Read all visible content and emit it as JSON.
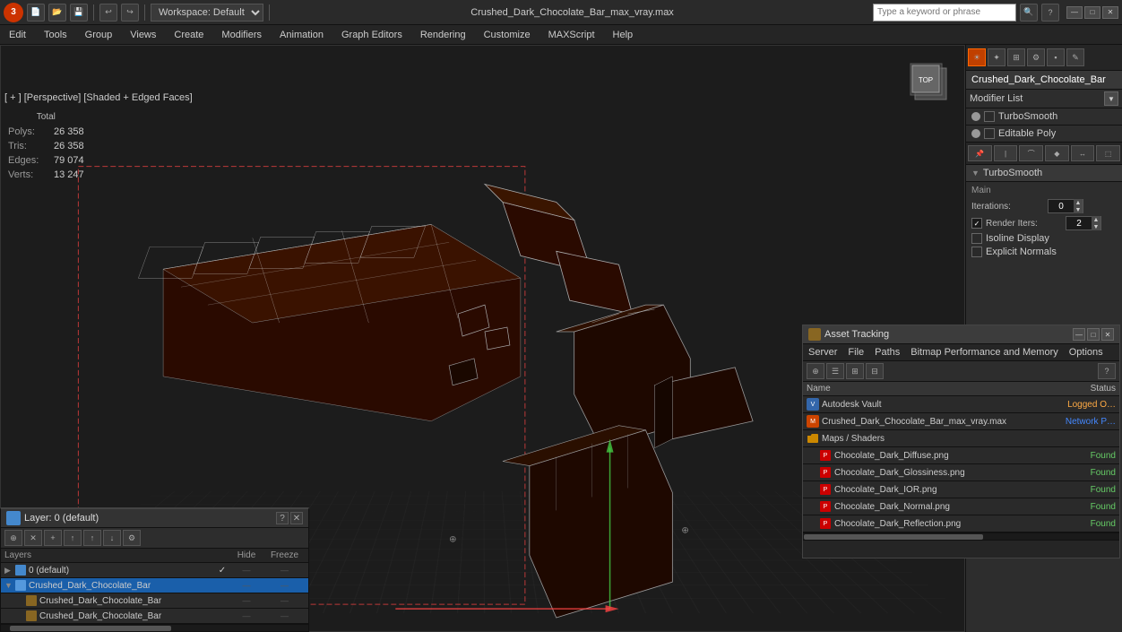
{
  "app": {
    "title": "Crushed_Dark_Chocolate_Bar_max_vray.max",
    "logo": "3",
    "workspace": "Workspace: Default"
  },
  "menu": {
    "items": [
      "Edit",
      "Tools",
      "Group",
      "Views",
      "Create",
      "Modifiers",
      "Animation",
      "Graph Editors",
      "Rendering",
      "Customize",
      "MAXScript",
      "Help"
    ]
  },
  "viewport": {
    "label": "[ + ] [Perspective] [Shaded + Edged Faces]",
    "stats": {
      "total_label": "Total",
      "polys_label": "Polys:",
      "polys_value": "26 358",
      "tris_label": "Tris:",
      "tris_value": "26 358",
      "edges_label": "Edges:",
      "edges_value": "79 074",
      "verts_label": "Verts:",
      "verts_value": "13 247"
    }
  },
  "right_panel": {
    "icons": [
      "⊕",
      "✦",
      "⊞",
      "⚙",
      "⬛",
      "✎"
    ],
    "object_name": "Crushed_Dark_Chocolate_Bar",
    "modifier_list_label": "Modifier List",
    "modifiers": [
      {
        "name": "TurboSmooth",
        "enabled": true
      },
      {
        "name": "Editable Poly",
        "enabled": true
      }
    ],
    "turbosmooth": {
      "title": "TurboSmooth",
      "main_label": "Main",
      "iterations_label": "Iterations:",
      "iterations_value": "0",
      "render_iters_label": "Render Iters:",
      "render_iters_value": "2",
      "isoline_label": "Isoline Display",
      "explicit_label": "Explicit Normals"
    }
  },
  "layers_panel": {
    "title": "Layer: 0 (default)",
    "columns": {
      "name": "Layers",
      "hide": "Hide",
      "freeze": "Freeze"
    },
    "layers": [
      {
        "indent": 0,
        "type": "layer",
        "name": "0 (default)",
        "checked": true,
        "is_default": true
      },
      {
        "indent": 0,
        "type": "layer",
        "name": "Crushed_Dark_Chocolate_Bar",
        "checked": false,
        "selected": true
      },
      {
        "indent": 1,
        "type": "object",
        "name": "Crushed_Dark_Chocolate_Bar",
        "checked": false
      },
      {
        "indent": 1,
        "type": "object",
        "name": "Crushed_Dark_Chocolate_Bar",
        "checked": false
      }
    ]
  },
  "asset_panel": {
    "title": "Asset Tracking",
    "menu_items": [
      "Server",
      "File",
      "Paths",
      "Bitmap Performance and Memory",
      "Options"
    ],
    "columns": {
      "name": "Name",
      "status": "Status"
    },
    "rows": [
      {
        "indent": 0,
        "type": "vault",
        "name": "Autodesk Vault",
        "status": "Logged O…"
      },
      {
        "indent": 0,
        "type": "file",
        "name": "Crushed_Dark_Chocolate_Bar_max_vray.max",
        "status": "Network P…"
      },
      {
        "indent": 0,
        "type": "folder",
        "name": "Maps / Shaders",
        "status": ""
      },
      {
        "indent": 1,
        "type": "png",
        "name": "Chocolate_Dark_Diffuse.png",
        "status": "Found"
      },
      {
        "indent": 1,
        "type": "png",
        "name": "Chocolate_Dark_Glossiness.png",
        "status": "Found"
      },
      {
        "indent": 1,
        "type": "png",
        "name": "Chocolate_Dark_IOR.png",
        "status": "Found"
      },
      {
        "indent": 1,
        "type": "png",
        "name": "Chocolate_Dark_Normal.png",
        "status": "Found"
      },
      {
        "indent": 1,
        "type": "png",
        "name": "Chocolate_Dark_Reflection.png",
        "status": "Found"
      }
    ]
  },
  "search": {
    "placeholder": "Type a keyword or phrase"
  }
}
